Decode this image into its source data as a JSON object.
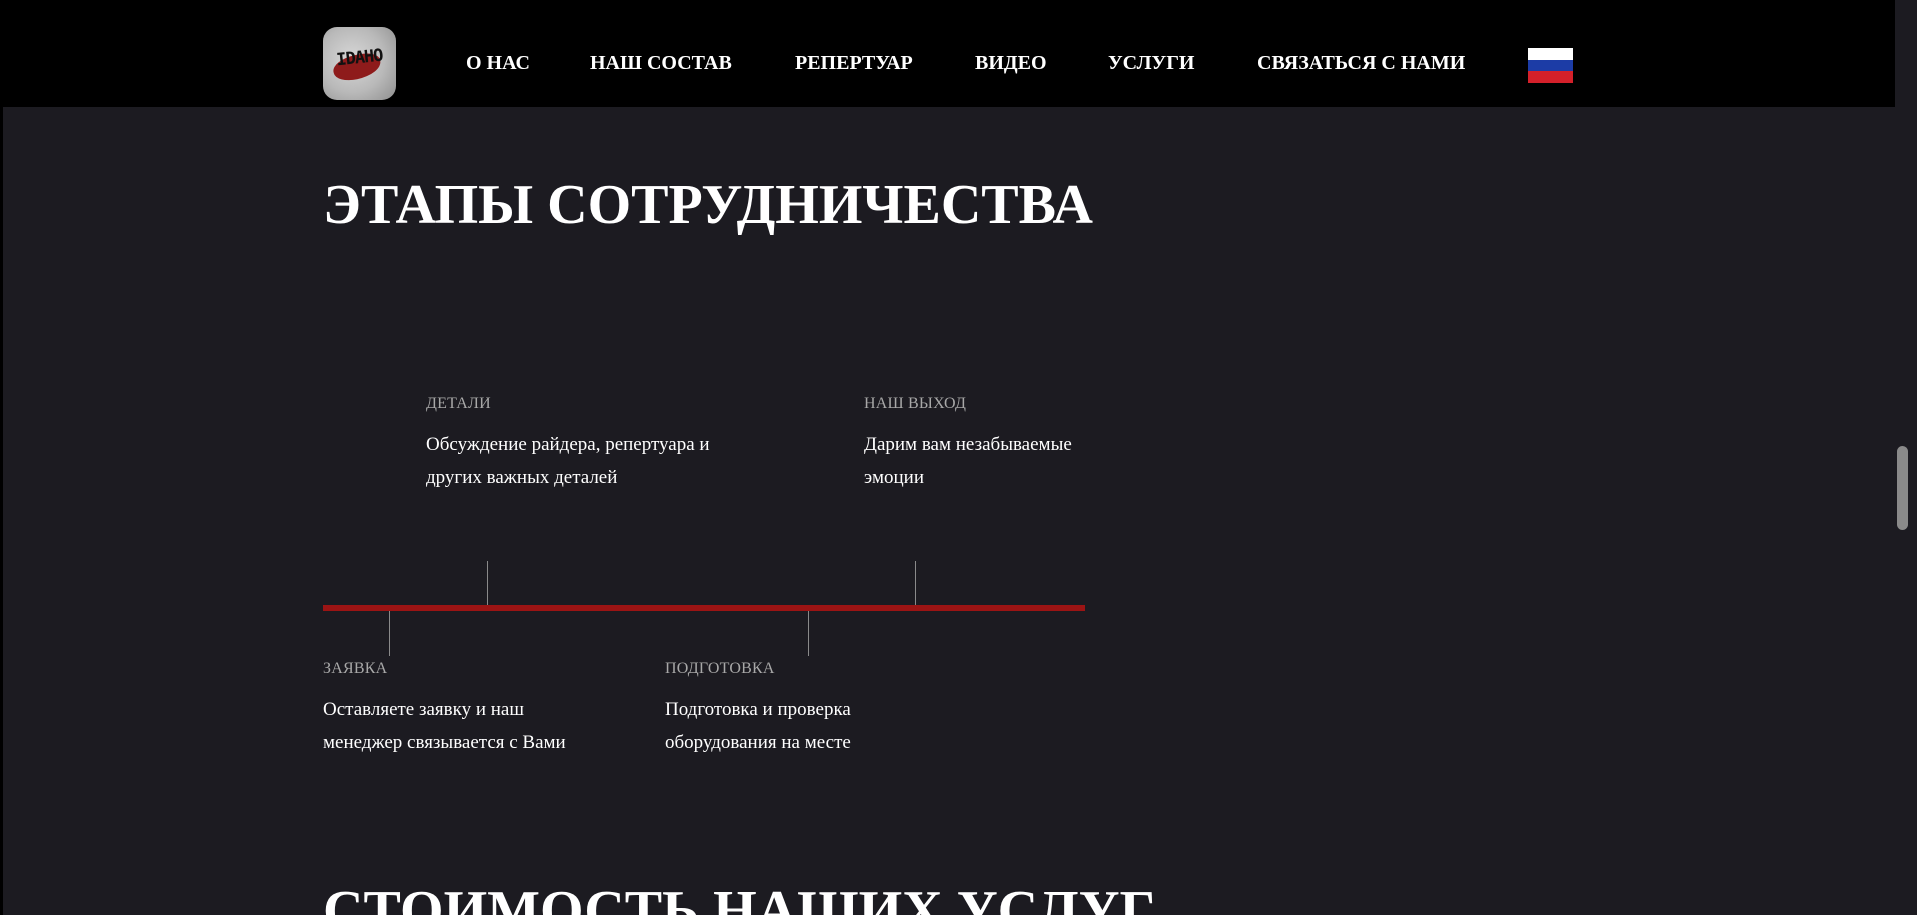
{
  "header": {
    "logo_text": "IDAHO",
    "nav": [
      "О НАС",
      "НАШ СОСТАВ",
      "РЕПЕРТУАР",
      "ВИДЕО",
      "УСЛУГИ",
      "СВЯЗАТЬСЯ С НАМИ"
    ],
    "language": "ru"
  },
  "stages": {
    "title": "ЭТАПЫ СОТРУДНИЧЕСТВА",
    "steps": [
      {
        "label": "ЗАЯВКА",
        "text": "Оставляете заявку и наш менеджер связывается с Вами"
      },
      {
        "label": "ДЕТАЛИ",
        "text": "Обсуждение райдера, репертуара и других важных деталей"
      },
      {
        "label": "ПОДГОТОВКА",
        "text": "Подготовка и проверка оборудования на месте"
      },
      {
        "label": "НАШ ВЫХОД",
        "text": "Дарим вам незабываемые эмоции"
      }
    ]
  },
  "pricing": {
    "title": "СТОИМОСТЬ НАШИХ УСЛУГ"
  },
  "colors": {
    "background": "#1c1b21",
    "header": "#000000",
    "accent": "#9b1414"
  }
}
